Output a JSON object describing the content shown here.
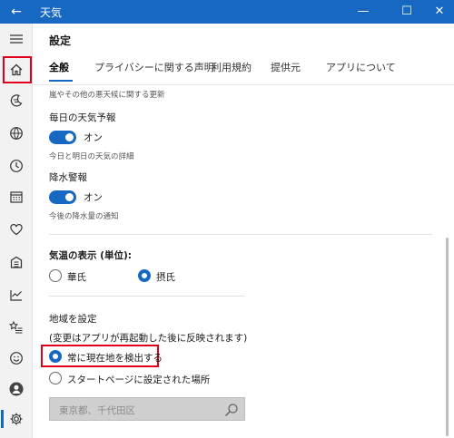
{
  "window": {
    "title": "天気",
    "back": "←",
    "minimize": "—",
    "maximize": "☐",
    "close": "✕"
  },
  "sidebar": {
    "items": [
      {
        "icon": "hamburger-menu-icon"
      },
      {
        "icon": "home-icon"
      },
      {
        "icon": "moon-forecast-icon"
      },
      {
        "icon": "globe-icon"
      },
      {
        "icon": "clock-history-icon"
      },
      {
        "icon": "calendar-icon"
      },
      {
        "icon": "heart-icon"
      },
      {
        "icon": "building-icon"
      },
      {
        "icon": "trend-chart-icon"
      },
      {
        "icon": "star-list-icon"
      },
      {
        "icon": "smiley-feedback-icon"
      },
      {
        "icon": "account-avatar-icon"
      },
      {
        "icon": "gear-settings-icon"
      }
    ]
  },
  "page": {
    "title": "設定"
  },
  "tabs": [
    {
      "label": "全般",
      "active": true
    },
    {
      "label": "プライバシーに関する声明"
    },
    {
      "label": "利用規約"
    },
    {
      "label": "提供元"
    },
    {
      "label": "アプリについて"
    }
  ],
  "settings": {
    "cut_top_text": "嵐やその他の悪天候に関する更新",
    "daily_forecast": {
      "title": "毎日の天気予報",
      "state": "オン",
      "desc": "今日と明日の天気の詳細"
    },
    "rain_alert": {
      "title": "降水警報",
      "state": "オン",
      "desc": "今後の降水量の通知"
    },
    "temperature": {
      "title": "気温の表示 (単位):",
      "options": [
        "華氏",
        "摂氏"
      ],
      "selected": "摂氏"
    },
    "location": {
      "title": "地域を設定",
      "note": "(変更はアプリが再起動した後に反映されます)",
      "options": [
        "常に現在地を検出する",
        "スタートページに設定された場所"
      ],
      "selected": "常に現在地を検出する",
      "search_placeholder": "東京都、千代田区"
    }
  },
  "colors": {
    "accent": "#1768c2",
    "highlight": "#e0001b",
    "titlebar": "#1768c2"
  }
}
